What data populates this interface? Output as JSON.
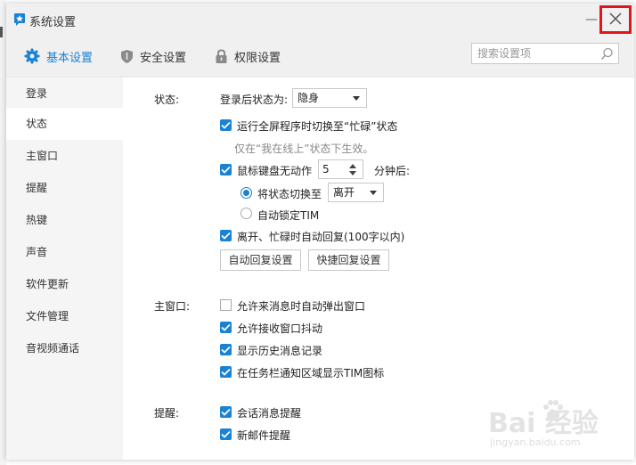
{
  "window": {
    "title": "系统设置",
    "close_icon": "close-icon",
    "minimize_icon": "minimize-icon",
    "highlight_color": "#e2161b",
    "accent_color": "#1a82d4"
  },
  "tabs": [
    {
      "label": "基本设置",
      "icon": "gear-icon",
      "active": true
    },
    {
      "label": "安全设置",
      "icon": "shield-icon",
      "active": false
    },
    {
      "label": "权限设置",
      "icon": "lock-icon",
      "active": false
    }
  ],
  "search": {
    "placeholder": "搜索设置项",
    "icon": "search-icon"
  },
  "sidebar": {
    "items": [
      {
        "label": "登录",
        "active": false
      },
      {
        "label": "状态",
        "active": true
      },
      {
        "label": "主窗口",
        "active": false
      },
      {
        "label": "提醒",
        "active": false
      },
      {
        "label": "热键",
        "active": false
      },
      {
        "label": "声音",
        "active": false
      },
      {
        "label": "软件更新",
        "active": false
      },
      {
        "label": "文件管理",
        "active": false
      },
      {
        "label": "音视频通话",
        "active": false
      }
    ]
  },
  "status": {
    "section_label": "状态:",
    "after_login_label": "登录后状态为:",
    "after_login_value": "隐身",
    "fullscreen_busy": {
      "label": "运行全屏程序时切换至“忙碌”状态",
      "checked": true
    },
    "fullscreen_hint": "仅在“我在线上”状态下生效。",
    "idle": {
      "label": "鼠标键盘无动作",
      "checked": true,
      "minutes": "5",
      "suffix": "分钟后:"
    },
    "switch_status": {
      "label": "将状态切换至",
      "selected": true,
      "value": "离开"
    },
    "auto_lock": {
      "label": "自动锁定TIM",
      "selected": false
    },
    "auto_reply": {
      "label": "离开、忙碌时自动回复(100字以内)",
      "checked": true
    },
    "auto_reply_button": "自动回复设置",
    "quick_reply_button": "快捷回复设置"
  },
  "main_window": {
    "section_label": "主窗口:",
    "options": [
      {
        "label": "允许来消息时自动弹出窗口",
        "checked": false
      },
      {
        "label": "允许接收窗口抖动",
        "checked": true
      },
      {
        "label": "显示历史消息记录",
        "checked": true
      },
      {
        "label": "在任务栏通知区域显示TIM图标",
        "checked": true
      }
    ]
  },
  "reminder": {
    "section_label": "提醒:",
    "options": [
      {
        "label": "会话消息提醒",
        "checked": true
      },
      {
        "label": "新邮件提醒",
        "checked": true
      }
    ]
  },
  "watermark": {
    "text": "Bai 经验",
    "url_text": "jingyan.baidu.com"
  }
}
